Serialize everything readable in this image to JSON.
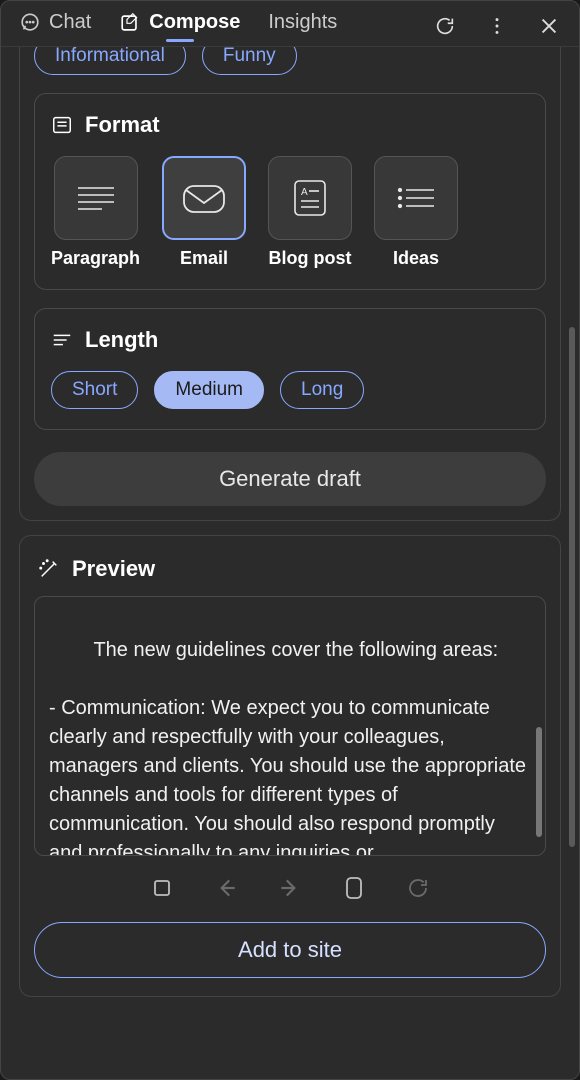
{
  "header": {
    "tabs": [
      {
        "label": "Chat",
        "active": false
      },
      {
        "label": "Compose",
        "active": true
      },
      {
        "label": "Insights",
        "active": false
      }
    ]
  },
  "tone": {
    "visible_options": [
      "Informational",
      "Funny"
    ]
  },
  "format": {
    "title": "Format",
    "options": [
      {
        "label": "Paragraph",
        "selected": false
      },
      {
        "label": "Email",
        "selected": true
      },
      {
        "label": "Blog post",
        "selected": false
      },
      {
        "label": "Ideas",
        "selected": false
      }
    ]
  },
  "length": {
    "title": "Length",
    "options": [
      {
        "label": "Short",
        "selected": false
      },
      {
        "label": "Medium",
        "selected": true
      },
      {
        "label": "Long",
        "selected": false
      }
    ]
  },
  "generate_label": "Generate draft",
  "preview": {
    "title": "Preview",
    "text": "The new guidelines cover the following areas:\n\n- Communication: We expect you to communicate clearly and respectfully with your colleagues, managers and clients. You should use the appropriate channels and tools for different types of communication. You should also respond promptly and professionally to any inquiries or"
  },
  "add_to_site_label": "Add to site"
}
